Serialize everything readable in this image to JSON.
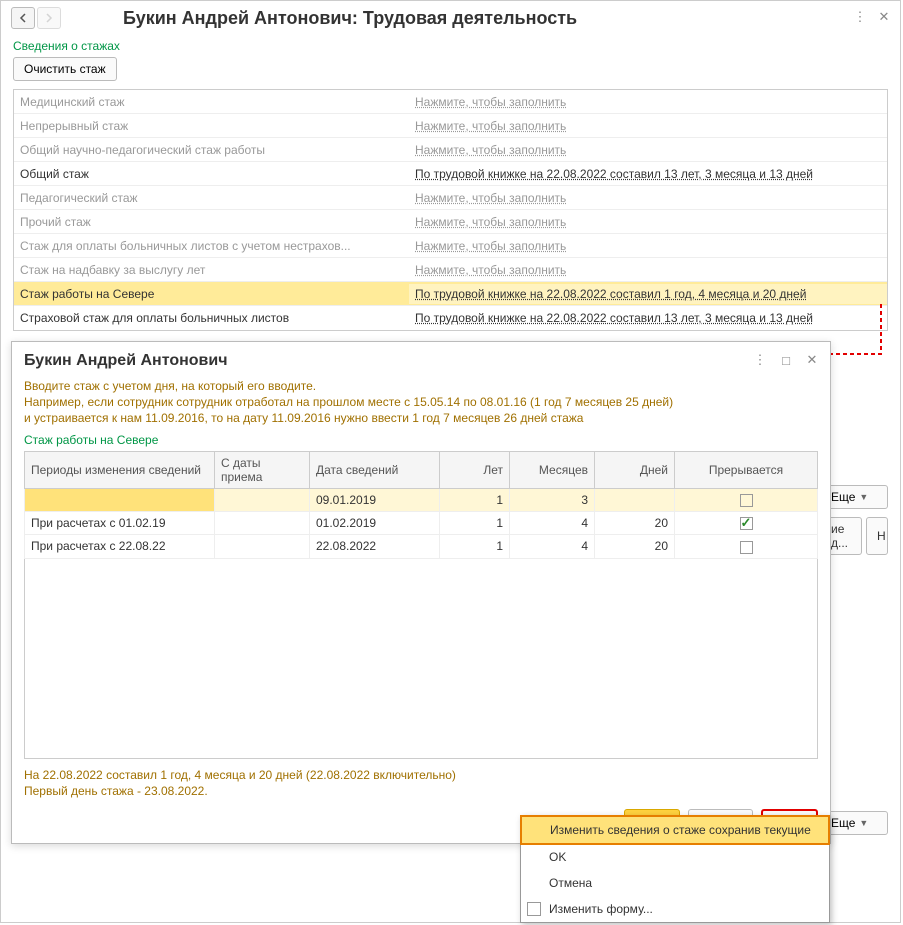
{
  "title": "Букин Андрей Антонович: Трудовая деятельность",
  "section_label": "Сведения о стажах",
  "clear_button": "Очистить стаж",
  "fill_placeholder": "Нажмите, чтобы заполнить",
  "rows": [
    {
      "label": "Медицинский стаж",
      "value_key": "fill",
      "gray": true
    },
    {
      "label": "Непрерывный стаж",
      "value_key": "fill",
      "gray": true
    },
    {
      "label": "Общий научно-педагогический стаж работы",
      "value_key": "fill",
      "gray": true
    },
    {
      "label": "Общий стаж",
      "value": "По трудовой книжке на 22.08.2022 составил 13 лет, 3 месяца и 13 дней",
      "gray": false
    },
    {
      "label": "Педагогический стаж",
      "value_key": "fill",
      "gray": true
    },
    {
      "label": "Прочий стаж",
      "value_key": "fill",
      "gray": true
    },
    {
      "label": "Стаж для оплаты больничных листов с учетом нестрахов...",
      "value_key": "fill",
      "gray": true
    },
    {
      "label": "Стаж на надбавку за выслугу лет",
      "value_key": "fill",
      "gray": true
    },
    {
      "label": "Стаж работы на Севере",
      "value": "По трудовой книжке на 22.08.2022 составил 1 год, 4 месяца и 20 дней",
      "gray": false,
      "selected": true
    },
    {
      "label": "Страховой стаж для оплаты больничных листов",
      "value": "По трудовой книжке на 22.08.2022 составил 13 лет, 3 месяца и 13 дней",
      "gray": false
    }
  ],
  "inner": {
    "title": "Букин Андрей Антонович",
    "hint1": "Вводите стаж с учетом дня, на который его вводите.",
    "hint2": "Например, если сотрудник сотрудник отработал на прошлом месте с 15.05.14 по 08.01.16 (1 год 7 месяцев 25 дней)",
    "hint3": "и устраивается к нам 11.09.2016, то на дату 11.09.2016 нужно ввести 1 год 7 месяцев 26 дней стажа",
    "sub_label": "Стаж работы на Севере",
    "headers": {
      "period": "Периоды изменения сведений",
      "from_hire": "С даты приема",
      "info_date": "Дата сведений",
      "years": "Лет",
      "months": "Месяцев",
      "days": "Дней",
      "interrupt": "Прерывается"
    },
    "rows": [
      {
        "period": "",
        "from_hire": "",
        "info_date": "09.01.2019",
        "years": "1",
        "months": "3",
        "days": "",
        "interrupt": false,
        "selected": true
      },
      {
        "period": "При расчетах с  01.02.19",
        "from_hire": "",
        "info_date": "01.02.2019",
        "years": "1",
        "months": "4",
        "days": "20",
        "interrupt": true
      },
      {
        "period": "При расчетах с  22.08.22",
        "from_hire": "",
        "info_date": "22.08.2022",
        "years": "1",
        "months": "4",
        "days": "20",
        "interrupt": false
      }
    ],
    "footer1": "На 22.08.2022 составил 1 год, 4 месяца и 20 дней (22.08.2022 включительно)",
    "footer2": "Первый день стажа - 23.08.2022.",
    "ok": "OK",
    "cancel": "Отмена",
    "more": "Еще"
  },
  "menu": {
    "item1": "Изменить сведения о стаже сохранив текущие",
    "item2": "OK",
    "item3": "Отмена",
    "item4": "Изменить форму..."
  },
  "rail": {
    "more": "Еще",
    "col1": "ие д...",
    "col2": "H"
  }
}
